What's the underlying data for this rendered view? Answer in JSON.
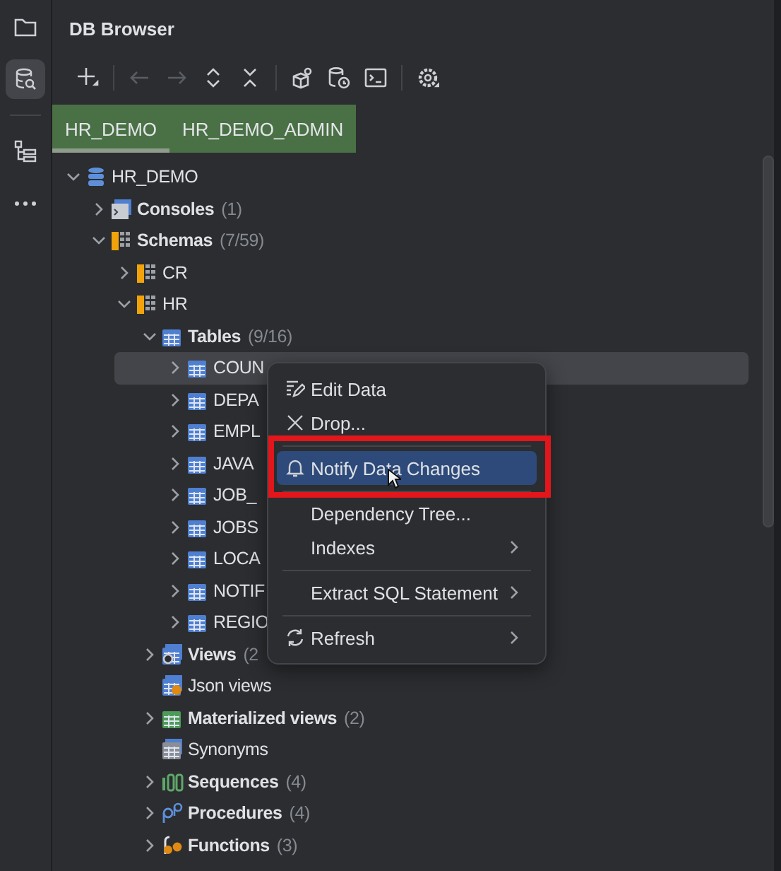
{
  "sidebar_icons": [
    {
      "kind": "folder",
      "selected": false
    },
    {
      "kind": "database",
      "selected": true
    },
    {
      "kind": "structure",
      "selected": false
    },
    {
      "kind": "more",
      "selected": false
    }
  ],
  "panel": {
    "title": "DB Browser"
  },
  "toolbar": [
    {
      "kind": "add",
      "disabled": false
    },
    {
      "kind": "separator"
    },
    {
      "kind": "back",
      "disabled": true
    },
    {
      "kind": "forward",
      "disabled": true
    },
    {
      "kind": "expand",
      "disabled": false
    },
    {
      "kind": "collapse",
      "disabled": false
    },
    {
      "kind": "separator"
    },
    {
      "kind": "objects",
      "disabled": false
    },
    {
      "kind": "history",
      "disabled": false
    },
    {
      "kind": "console",
      "disabled": false
    },
    {
      "kind": "separator"
    },
    {
      "kind": "settings",
      "disabled": false
    }
  ],
  "tabs": [
    {
      "label": "HR_DEMO",
      "selected": true
    },
    {
      "label": "HR_DEMO_ADMIN",
      "selected": false
    }
  ],
  "tree": [
    {
      "label": "HR_DEMO",
      "kind": "database",
      "bold": false,
      "expanded": true,
      "selected": false,
      "children": [
        {
          "label": "Consoles",
          "count": "(1)",
          "kind": "console",
          "bold": true,
          "expanded": false,
          "selected": false
        },
        {
          "label": "Schemas",
          "count": "(7/59)",
          "kind": "schema",
          "bold": true,
          "expanded": true,
          "selected": false,
          "children": [
            {
              "label": "CR",
              "kind": "schema",
              "bold": false,
              "expanded": false,
              "selected": false
            },
            {
              "label": "HR",
              "kind": "schema",
              "bold": false,
              "expanded": true,
              "selected": false,
              "children": [
                {
                  "label": "Tables",
                  "count": "(9/16)",
                  "kind": "table",
                  "bold": true,
                  "expanded": true,
                  "selected": false,
                  "children": [
                    {
                      "label": "COUN",
                      "kind": "table",
                      "bold": false,
                      "expanded": false,
                      "selected": true
                    },
                    {
                      "label": "DEPA",
                      "kind": "table",
                      "bold": false,
                      "expanded": false,
                      "selected": false
                    },
                    {
                      "label": "EMPL",
                      "kind": "table",
                      "bold": false,
                      "expanded": false,
                      "selected": false
                    },
                    {
                      "label": "JAVA",
                      "kind": "table",
                      "bold": false,
                      "expanded": false,
                      "selected": false
                    },
                    {
                      "label": "JOB_",
                      "kind": "table",
                      "bold": false,
                      "expanded": false,
                      "selected": false
                    },
                    {
                      "label": "JOBS",
                      "kind": "table",
                      "bold": false,
                      "expanded": false,
                      "selected": false
                    },
                    {
                      "label": "LOCA",
                      "kind": "table",
                      "bold": false,
                      "expanded": false,
                      "selected": false
                    },
                    {
                      "label": "NOTIF",
                      "kind": "table",
                      "bold": false,
                      "expanded": false,
                      "selected": false
                    },
                    {
                      "label": "REGIO",
                      "kind": "table",
                      "bold": false,
                      "expanded": false,
                      "selected": false
                    }
                  ]
                },
                {
                  "label": "Views",
                  "count": "(2",
                  "kind": "view",
                  "bold": true,
                  "expanded": false,
                  "selected": false
                },
                {
                  "label": "Json views",
                  "kind": "json",
                  "bold": false,
                  "selected": false
                },
                {
                  "label": "Materialized views",
                  "count": "(2)",
                  "kind": "matview",
                  "bold": true,
                  "expanded": false,
                  "selected": false
                },
                {
                  "label": "Synonyms",
                  "kind": "synonym",
                  "bold": false,
                  "selected": false
                },
                {
                  "label": "Sequences",
                  "count": "(4)",
                  "kind": "sequence",
                  "bold": true,
                  "expanded": false,
                  "selected": false
                },
                {
                  "label": "Procedures",
                  "count": "(4)",
                  "kind": "procedure",
                  "bold": true,
                  "expanded": false,
                  "selected": false
                },
                {
                  "label": "Functions",
                  "count": "(3)",
                  "kind": "function",
                  "bold": true,
                  "expanded": false,
                  "selected": false
                }
              ]
            }
          ]
        }
      ]
    }
  ],
  "context_menu": {
    "items": [
      {
        "kind": "edit",
        "label": "Edit Data",
        "submenu": false,
        "selected": false
      },
      {
        "kind": "close",
        "label": "Drop...",
        "submenu": false,
        "selected": false
      },
      {
        "kind": "separator"
      },
      {
        "kind": "bell",
        "label": "Notify Data Changes",
        "submenu": false,
        "selected": true
      },
      {
        "kind": "separator"
      },
      {
        "kind": "plain",
        "label": "Dependency Tree...",
        "submenu": false,
        "selected": false
      },
      {
        "kind": "plain",
        "label": "Indexes",
        "submenu": true,
        "selected": false
      },
      {
        "kind": "separator"
      },
      {
        "kind": "plain",
        "label": "Extract SQL Statement",
        "submenu": true,
        "selected": false
      },
      {
        "kind": "separator"
      },
      {
        "kind": "refresh",
        "label": "Refresh",
        "submenu": true,
        "selected": false
      }
    ],
    "highlighted": true
  }
}
